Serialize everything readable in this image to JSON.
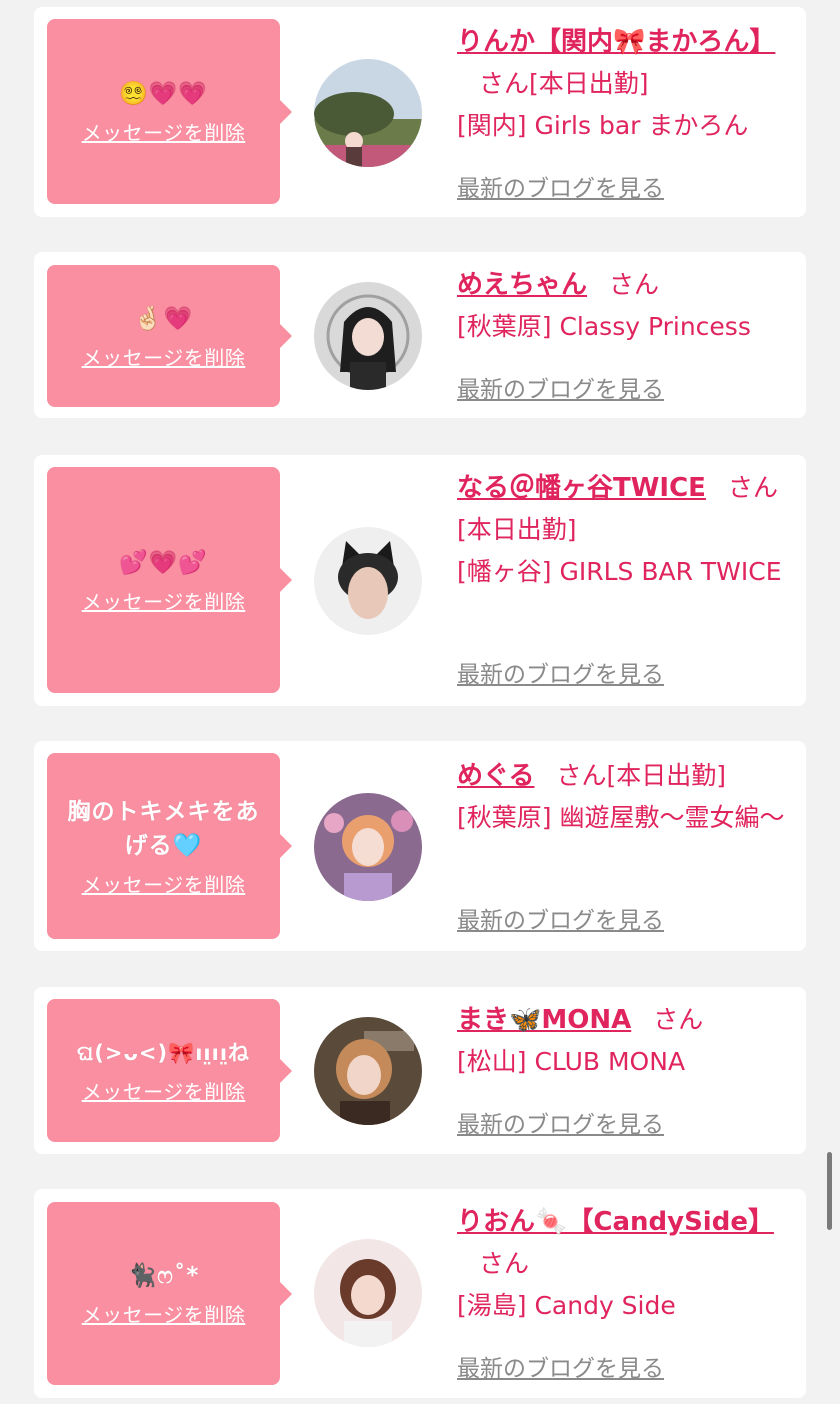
{
  "cards": [
    {
      "message": "😵‍💫💗💗",
      "delete_label": "メッセージを削除",
      "name": "りんか【関内🎀まかろん】",
      "suffix": "さん",
      "status": "[本日出勤]",
      "shop": "[関内] Girls bar まかろん",
      "blog_label": "最新のブログを見る",
      "avatar_icon": "avatar-photo-garden"
    },
    {
      "message": "🤞🏻💗",
      "delete_label": "メッセージを削除",
      "name": "めえちゃん",
      "suffix": "さん",
      "status": "",
      "shop": "[秋葉原] Classy Princess",
      "blog_label": "最新のブログを見る",
      "avatar_icon": "avatar-photo-gothic"
    },
    {
      "message": "💕💗💕",
      "delete_label": "メッセージを削除",
      "name": "なる＠幡ヶ谷TWICE",
      "suffix": "さん",
      "status": "[本日出勤]",
      "shop": "[幡ヶ谷] GIRLS BAR TWICE",
      "blog_label": "最新のブログを見る",
      "avatar_icon": "avatar-photo-cat-ears"
    },
    {
      "message": "胸のトキメキをあげる🩵",
      "delete_label": "メッセージを削除",
      "name": "めぐる",
      "suffix": "さん",
      "status": "[本日出勤]",
      "shop": "[秋葉原] 幽遊屋敷〜霊女編〜",
      "blog_label": "最新のブログを見る",
      "avatar_icon": "avatar-photo-purple"
    },
    {
      "message": "ଘ(>ᴗ<)🎀ıı̤ıı̤ね",
      "delete_label": "メッセージを削除",
      "name": "まき🦋MONA",
      "suffix": "さん",
      "status": "",
      "shop": "[松山] CLUB MONA",
      "blog_label": "最新のブログを見る",
      "avatar_icon": "avatar-photo-club"
    },
    {
      "message": "🐈‍⬛ෆ˚*",
      "delete_label": "メッセージを削除",
      "name": "りおん🍬【CandySide】",
      "suffix": "さん",
      "status": "",
      "shop": "[湯島] Candy Side",
      "blog_label": "最新のブログを見る",
      "avatar_icon": "avatar-photo-candy"
    }
  ],
  "colors": {
    "background": "#f2f2f2",
    "card": "#ffffff",
    "bubble": "#f98fa0",
    "name": "#e0245e",
    "blog_link": "#8a8a8a"
  }
}
